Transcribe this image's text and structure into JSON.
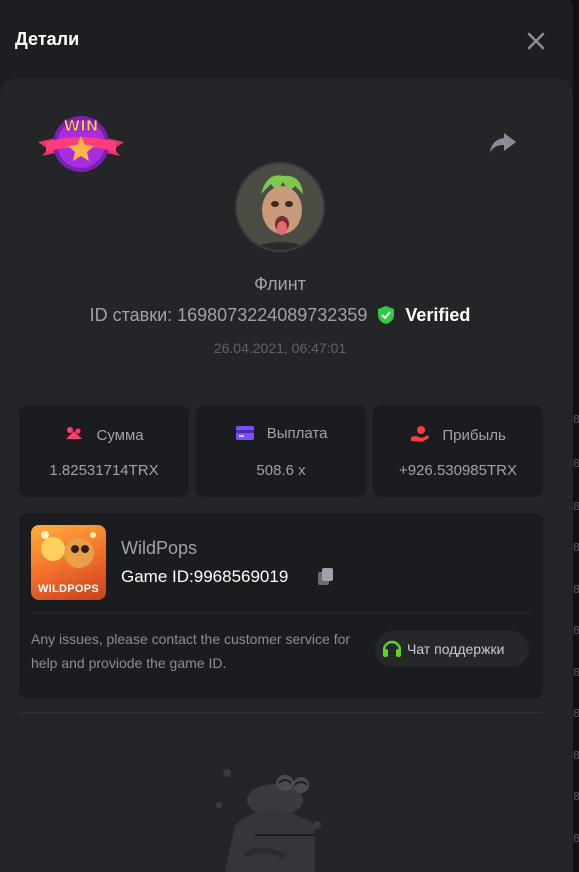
{
  "header": {
    "title": "Детали",
    "close_icon": "close-icon"
  },
  "bet": {
    "username": "Флинт",
    "bet_id_label": "ID ставки:",
    "bet_id": "1698073224089732359",
    "verified_label": "Verified",
    "datetime": "26.04.2021, 06:47:01",
    "badge_text": "WIN"
  },
  "stats": [
    {
      "label": "Сумма",
      "value": "1.82531714TRX",
      "icon": "coins-icon"
    },
    {
      "label": "Выплата",
      "value": "508.6 x",
      "icon": "wallet-icon"
    },
    {
      "label": "Прибыль",
      "value": "+926.530985TRX",
      "icon": "profit-hand-icon"
    }
  ],
  "game": {
    "name": "WildPops",
    "id_label": "Game ID:",
    "id": "9968569019",
    "thumb_label": "WILDPOPS",
    "help_text": "Any issues, please contact the customer service for help and proviode the game ID.",
    "support_label": "Чат поддержки"
  },
  "side_digits": [
    "8",
    "8",
    "8",
    "8",
    "8",
    "8",
    "8",
    "8",
    "8",
    "8",
    "8"
  ],
  "colors": {
    "verified_green": "#2ecc40",
    "accent_pink": "#ff3d6e",
    "accent_purple": "#7b4dff",
    "accent_red": "#ff3b3b",
    "support_green": "#5fd41e"
  }
}
